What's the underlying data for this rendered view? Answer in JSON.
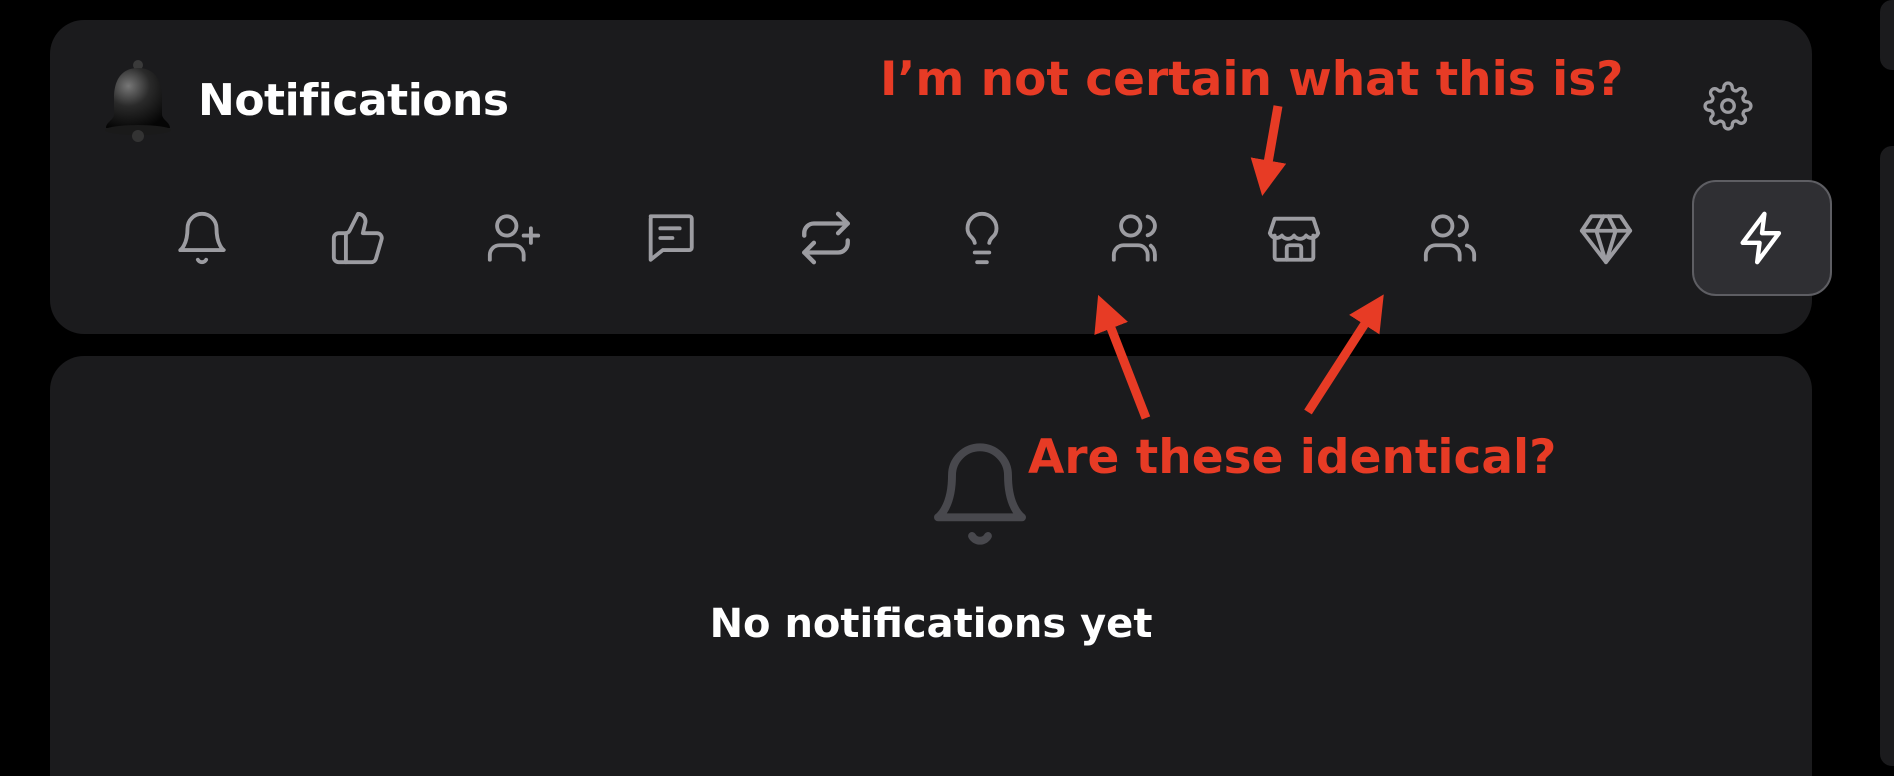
{
  "header": {
    "title": "Notifications",
    "settings_icon": "gear-icon"
  },
  "tabs": [
    {
      "icon": "bell-icon",
      "name": "All"
    },
    {
      "icon": "thumbs-up-icon",
      "name": "Likes"
    },
    {
      "icon": "user-plus-icon",
      "name": "Follows"
    },
    {
      "icon": "message-icon",
      "name": "Comments"
    },
    {
      "icon": "repost-icon",
      "name": "Reposts"
    },
    {
      "icon": "lightbulb-icon",
      "name": "Tips"
    },
    {
      "icon": "users-icon",
      "name": "Community"
    },
    {
      "icon": "store-icon",
      "name": "Store"
    },
    {
      "icon": "users-icon",
      "name": "Groups"
    },
    {
      "icon": "gem-icon",
      "name": "Premium"
    },
    {
      "icon": "lightning-icon",
      "name": "Activity",
      "active": true
    }
  ],
  "empty_state": {
    "icon": "bell-icon",
    "message": "No notifications yet"
  },
  "annotations": {
    "top": "I’m not certain what this is?",
    "bottom": "Are these identical?"
  },
  "colors": {
    "background": "#000000",
    "panel": "#1b1b1d",
    "icon": "#9c9ca1",
    "annotation": "#e73b25",
    "active_tab": "#2f2f33"
  }
}
